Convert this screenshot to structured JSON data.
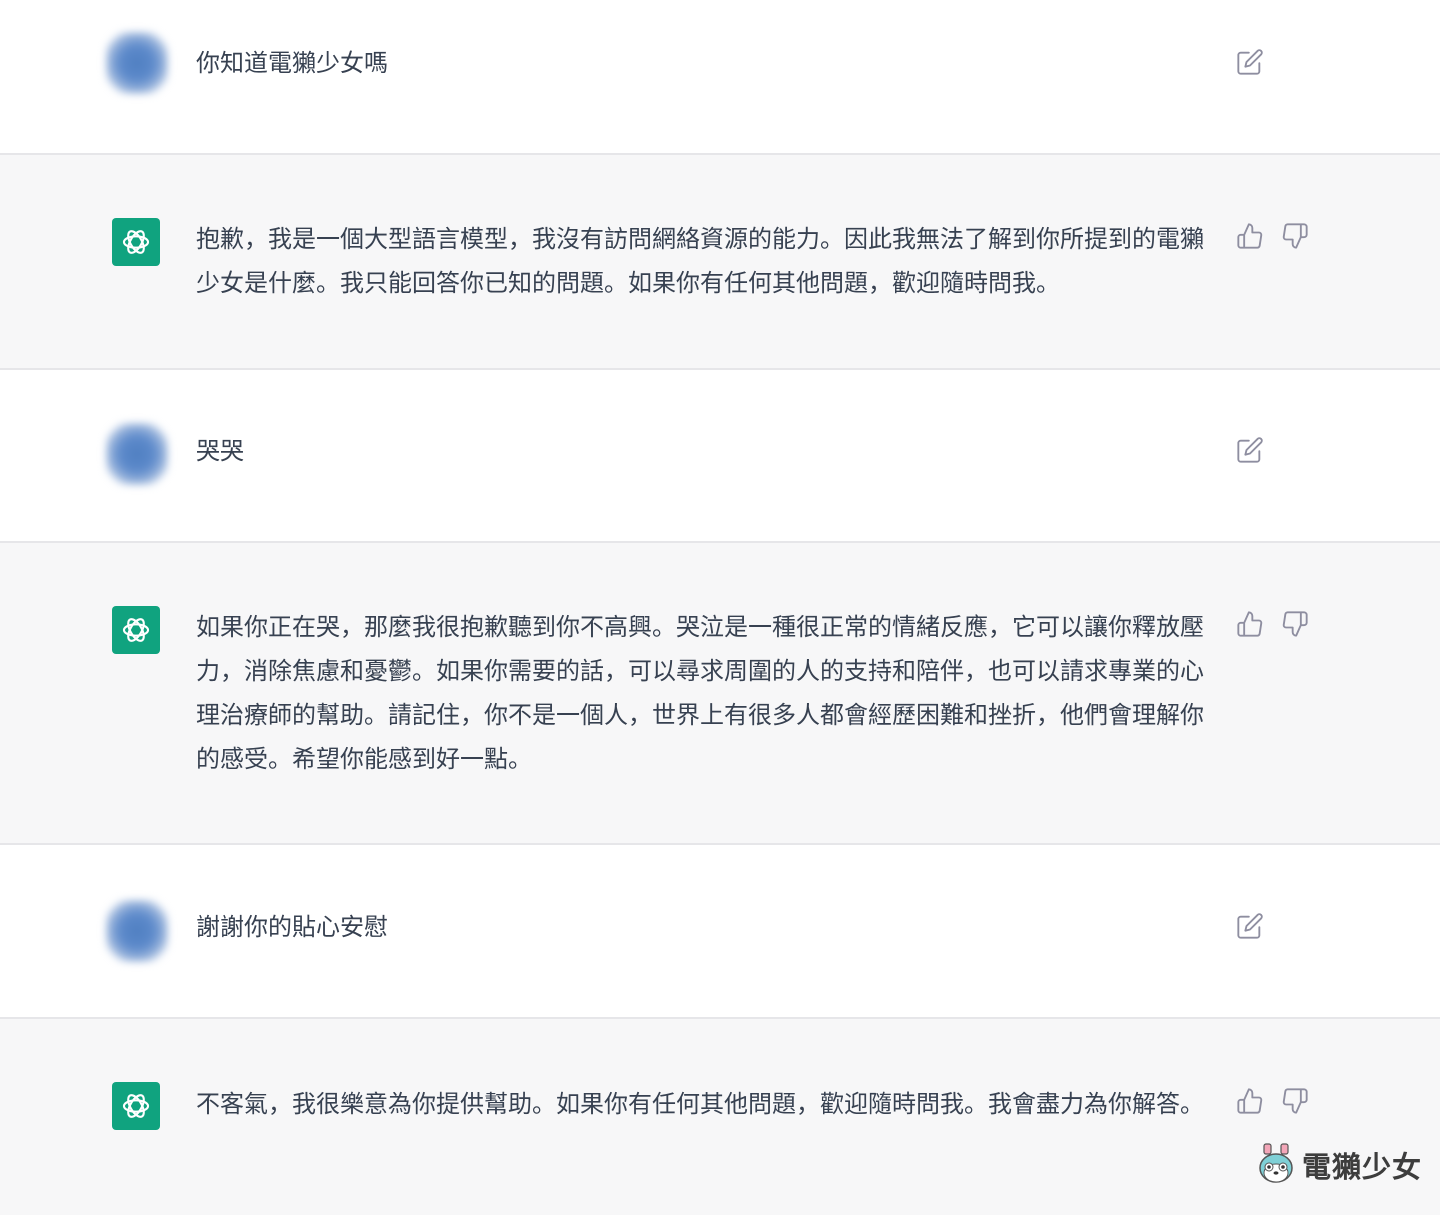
{
  "conversation": {
    "messages": [
      {
        "role": "user",
        "text": "你知道電獺少女嗎"
      },
      {
        "role": "assistant",
        "text": "抱歉，我是一個大型語言模型，我沒有訪問網絡資源的能力。因此我無法了解到你所提到的電獺少女是什麼。我只能回答你已知的問題。如果你有任何其他問題，歡迎隨時問我。"
      },
      {
        "role": "user",
        "text": "哭哭"
      },
      {
        "role": "assistant",
        "text": "如果你正在哭，那麼我很抱歉聽到你不高興。哭泣是一種很正常的情緒反應，它可以讓你釋放壓力，消除焦慮和憂鬱。如果你需要的話，可以尋求周圍的人的支持和陪伴，也可以請求專業的心理治療師的幫助。請記住，你不是一個人，世界上有很多人都會經歷困難和挫折，他們會理解你的感受。希望你能感到好一點。"
      },
      {
        "role": "user",
        "text": "謝謝你的貼心安慰"
      },
      {
        "role": "assistant",
        "text": "不客氣，我很樂意為你提供幫助。如果你有任何其他問題，歡迎隨時問我。我會盡力為你解答。"
      }
    ]
  },
  "icons": {
    "user_action": "edit-icon",
    "assistant_actions": [
      "thumbs-up-icon",
      "thumbs-down-icon"
    ],
    "assistant_avatar": "openai-logo-icon"
  },
  "colors": {
    "assistant_bg": "#f7f7f8",
    "user_bg": "#ffffff",
    "avatar_green": "#10a37f",
    "text": "#374151",
    "icon": "#8e8ea0"
  },
  "watermark": {
    "text": "電獺少女"
  }
}
